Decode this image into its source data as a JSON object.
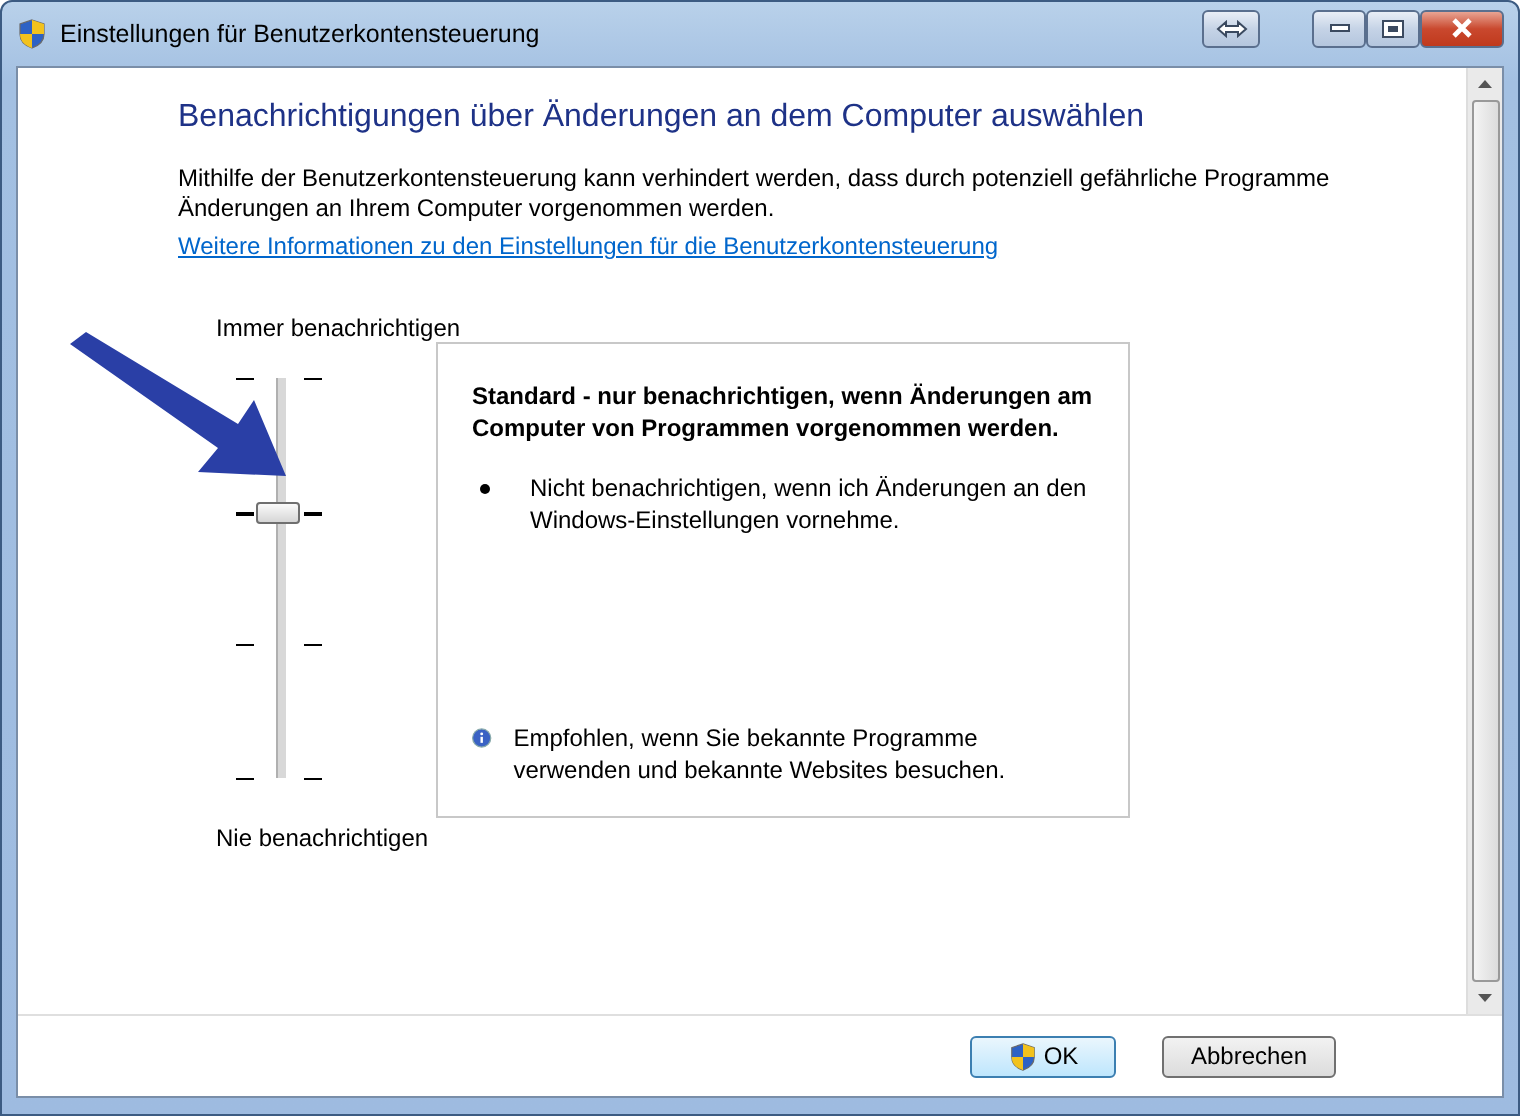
{
  "window": {
    "title": "Einstellungen für Benutzerkontensteuerung"
  },
  "heading": "Benachrichtigungen über Änderungen an dem Computer auswählen",
  "description": "Mithilfe der Benutzerkontensteuerung kann verhindert werden, dass durch potenziell gefährliche Programme Änderungen an Ihrem Computer vorgenommen werden.",
  "link": "Weitere Informationen zu den Einstellungen für die Benutzerkontensteuerung",
  "slider": {
    "top_label": "Immer benachrichtigen",
    "bottom_label": "Nie benachrichtigen",
    "level": 0.667
  },
  "info_box": {
    "title": "Standard - nur benachrichtigen, wenn Änderungen am Computer von Programmen vorgenommen werden.",
    "bullets": [
      "Nicht benachrichtigen, wenn ich Änderungen an den Windows-Einstellungen vornehme."
    ],
    "note": "Empfohlen, wenn Sie bekannte Programme verwenden und bekannte Websites besuchen."
  },
  "buttons": [
    {
      "label": "OK",
      "kind": "default"
    },
    {
      "label": "Abbrechen",
      "kind": "normal"
    }
  ]
}
